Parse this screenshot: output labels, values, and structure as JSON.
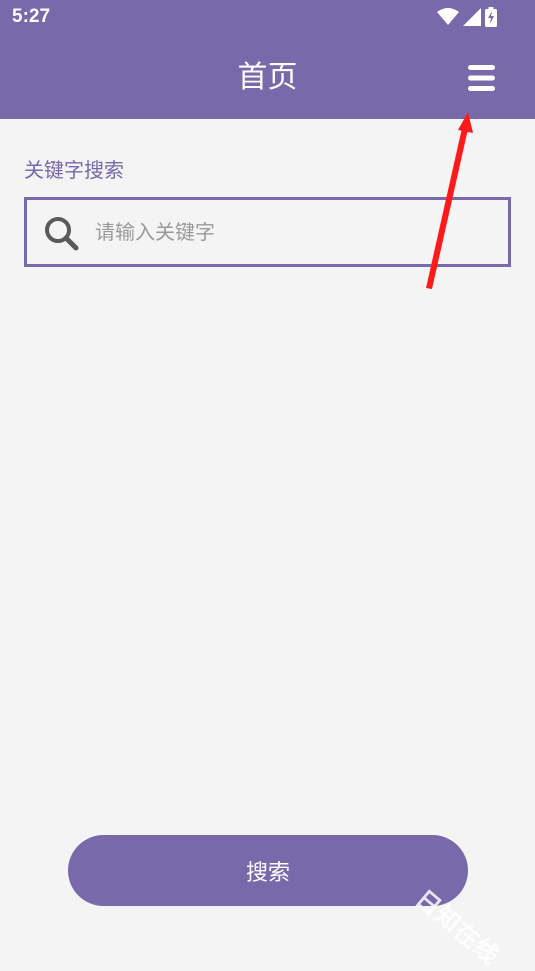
{
  "status_bar": {
    "time": "5:27",
    "icons": [
      "wifi-icon",
      "signal-icon",
      "battery-charging-icon"
    ]
  },
  "header": {
    "title": "首页",
    "menu_icon": "hamburger-menu-icon"
  },
  "search": {
    "label": "关键字搜索",
    "placeholder": "请输入关键字",
    "value": "",
    "icon": "search-icon"
  },
  "actions": {
    "search_button_label": "搜索"
  },
  "watermark": {
    "text": "日知在线"
  },
  "colors": {
    "primary": "#7869ab",
    "background": "#f4f4f4",
    "annotation": "#ff1a1a"
  }
}
